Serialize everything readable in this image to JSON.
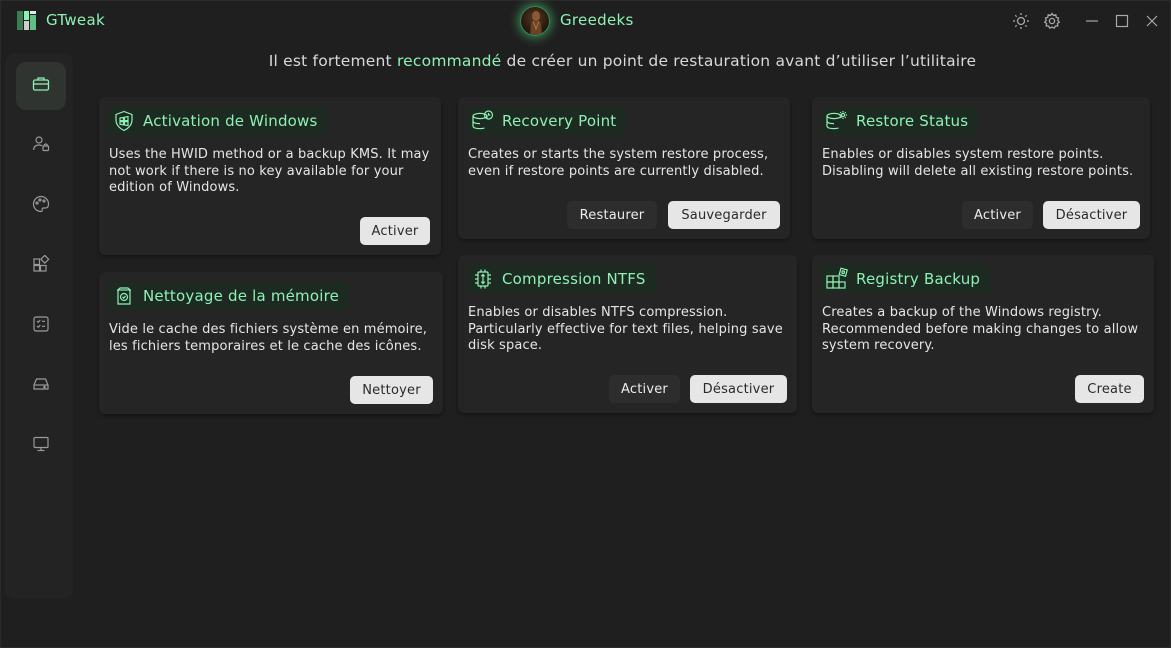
{
  "app": {
    "title": "GTweak"
  },
  "user": {
    "name": "Greedeks"
  },
  "titlebar": {
    "icons": [
      "sun-icon",
      "gear-icon",
      "minimize-icon",
      "maximize-icon",
      "close-icon"
    ]
  },
  "sidebar": {
    "items": [
      {
        "icon": "briefcase-icon",
        "active": true
      },
      {
        "icon": "user-lock-icon",
        "active": false
      },
      {
        "icon": "palette-icon",
        "active": false
      },
      {
        "icon": "apps-icon",
        "active": false
      },
      {
        "icon": "checklist-icon",
        "active": false
      },
      {
        "icon": "drive-icon",
        "active": false
      },
      {
        "icon": "monitor-icon",
        "active": false
      }
    ]
  },
  "banner": {
    "before": "Il est fortement ",
    "accent": "recommandé",
    "after": " de créer un point de restauration avant d’utiliser l’utilitaire"
  },
  "cards": {
    "activation": {
      "title": "Activation de Windows",
      "icon": "shield-windows-icon",
      "desc": "Uses the HWID method or a backup KMS. It may not work if there is no key available for your edition of Windows.",
      "button": "Activer"
    },
    "recovery": {
      "title": "Recovery Point",
      "icon": "database-clock-icon",
      "desc": "Creates or starts the system restore process, even if restore points are currently disabled.",
      "button_restore": "Restaurer",
      "button_save": "Sauvegarder"
    },
    "restore_status": {
      "title": "Restore Status",
      "icon": "database-gear-icon",
      "desc": "Enables or disables system restore points. Disabling will delete all existing restore points.",
      "button_on": "Activer",
      "button_off": "Désactiver"
    },
    "memory": {
      "title": "Nettoyage de la mémoire",
      "icon": "memory-clean-icon",
      "desc": "Vide le cache des fichiers système en mémoire, les fichiers temporaires et le cache des icônes.",
      "button": "Nettoyer"
    },
    "ntfs": {
      "title": "Compression NTFS",
      "icon": "chip-compress-icon",
      "desc": "Enables or disables NTFS compression. Particularly effective for text files, helping save disk space.",
      "button_on": "Activer",
      "button_off": "Désactiver"
    },
    "registry": {
      "title": "Registry Backup",
      "icon": "registry-icon",
      "desc": "Creates a backup of the Windows registry. Recommended before making changes to allow system recovery.",
      "button": "Create"
    }
  },
  "colors": {
    "accent": "#8ff0b5",
    "background": "#1f1f1f",
    "card": "#252525"
  }
}
